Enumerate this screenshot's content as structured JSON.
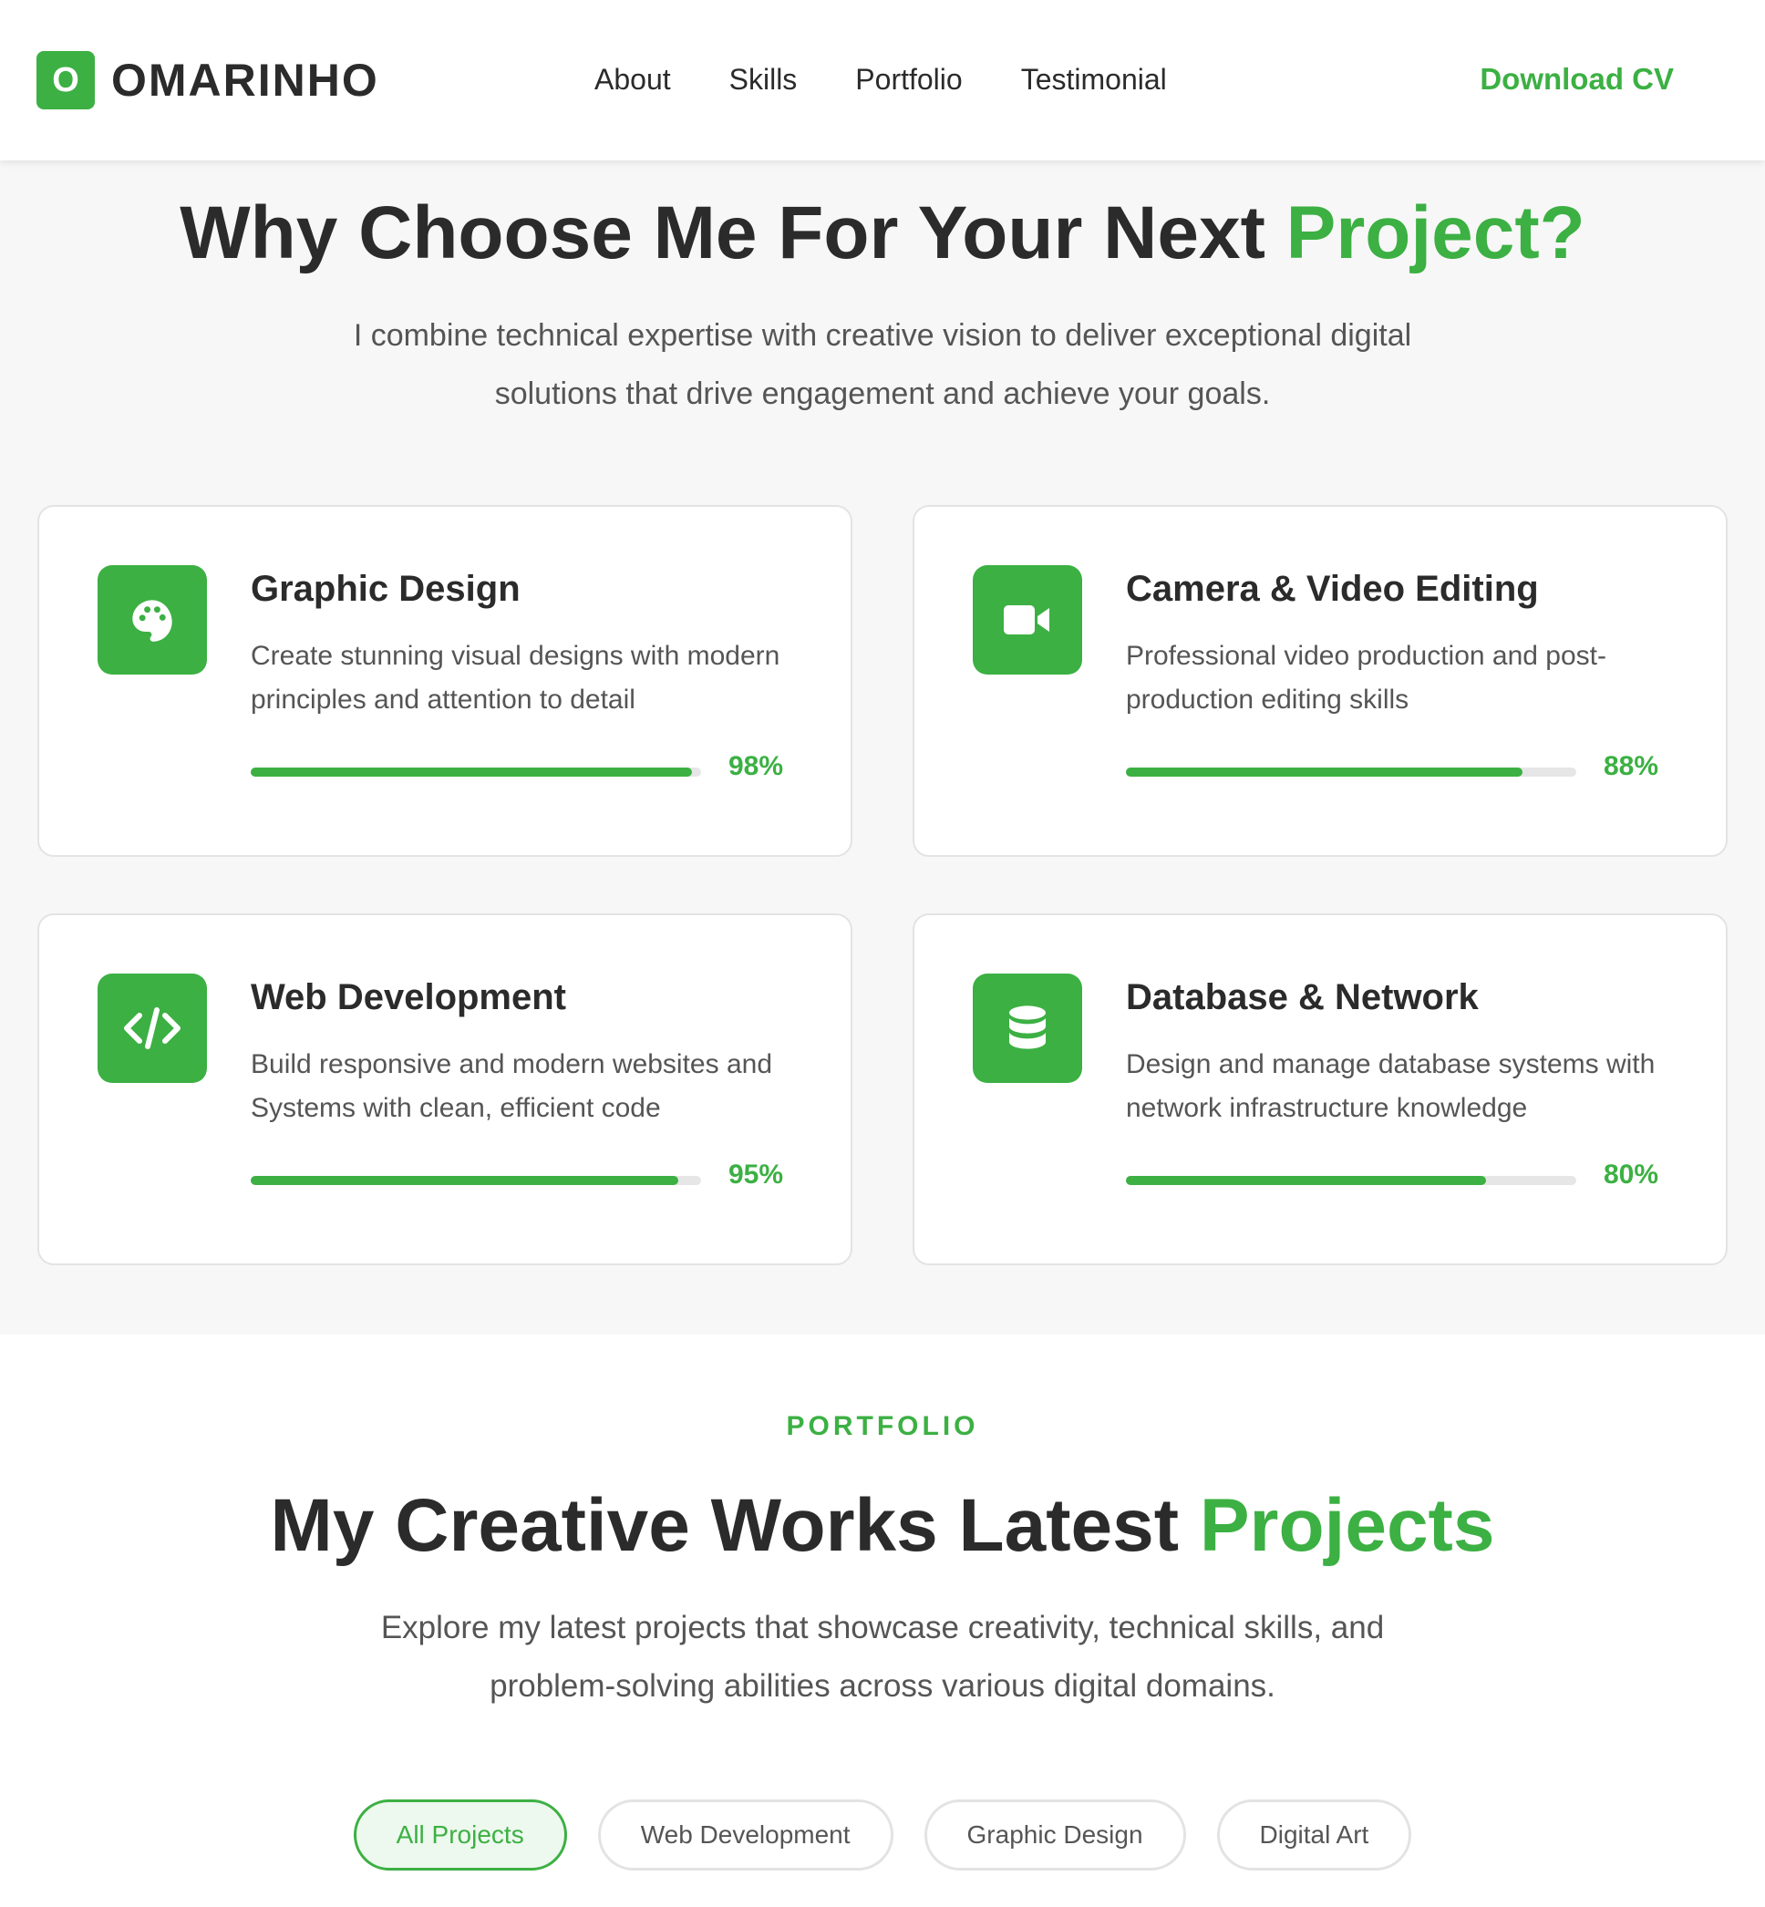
{
  "colors": {
    "accent": "#3cb043",
    "text_dark": "#2b2b2b",
    "text_muted": "#555555"
  },
  "header": {
    "logo_letter": "O",
    "logo_text": "OMARINHO",
    "nav": [
      "About",
      "Skills",
      "Portfolio",
      "Testimonial"
    ],
    "download_label": "Download CV"
  },
  "why": {
    "title_main": "Why Choose Me For Your Next ",
    "title_accent": "Project?",
    "description": "I combine technical expertise with creative vision to deliver exceptional digital solutions that drive engagement and achieve your goals.",
    "cards": [
      {
        "icon": "palette-icon",
        "title": "Graphic Design",
        "description": "Create stunning visual designs with modern principles and attention to detail",
        "percent": 98,
        "percent_label": "98%"
      },
      {
        "icon": "video-camera-icon",
        "title": "Camera & Video Editing",
        "description": "Professional video production and post-production editing skills",
        "percent": 88,
        "percent_label": "88%"
      },
      {
        "icon": "code-icon",
        "title": "Web Development",
        "description": "Build responsive and modern websites and Systems with clean, efficient code",
        "percent": 95,
        "percent_label": "95%"
      },
      {
        "icon": "database-icon",
        "title": "Database & Network",
        "description": "Design and manage database systems with network infrastructure knowledge",
        "percent": 80,
        "percent_label": "80%"
      }
    ]
  },
  "portfolio": {
    "label": "PORTFOLIO",
    "title_main": "My Creative Works Latest ",
    "title_accent": "Projects",
    "description": "Explore my latest projects that showcase creativity, technical skills, and problem-solving abilities across various digital domains.",
    "filters": [
      {
        "label": "All Projects",
        "active": true
      },
      {
        "label": "Web Development",
        "active": false
      },
      {
        "label": "Graphic Design",
        "active": false
      },
      {
        "label": "Digital Art",
        "active": false
      }
    ]
  }
}
